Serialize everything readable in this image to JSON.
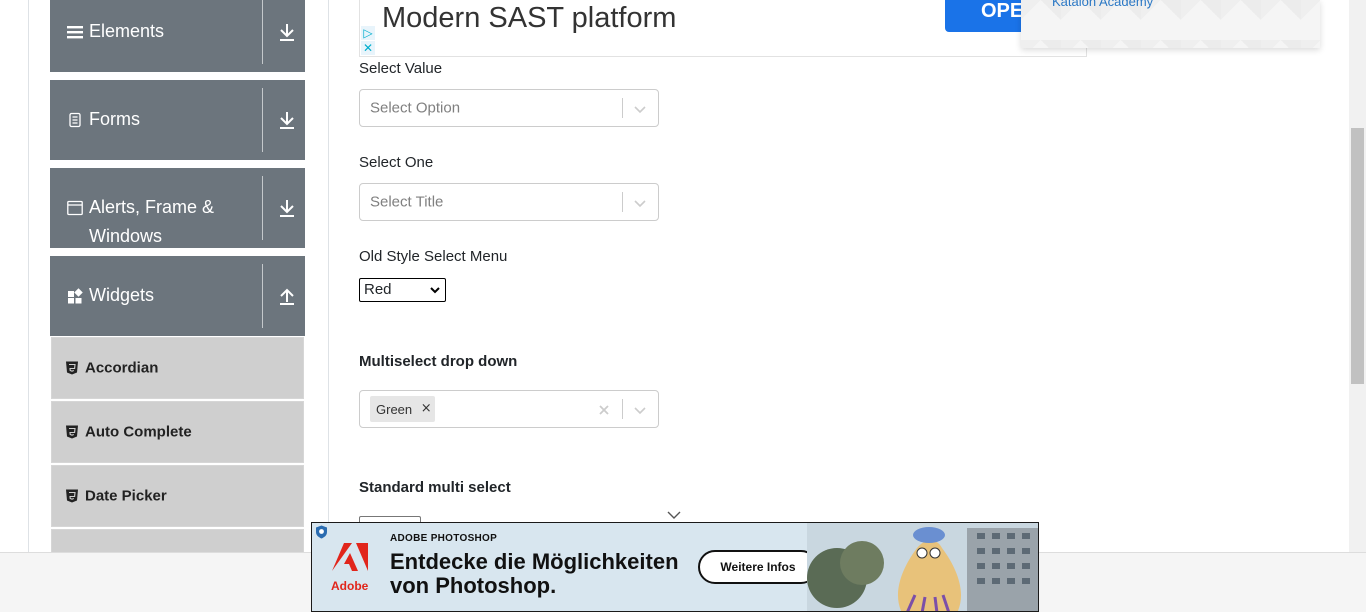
{
  "sidebar": {
    "groups": [
      {
        "label": "Elements",
        "icon": "hamburger-icon",
        "arrow": "download-icon"
      },
      {
        "label": "Forms",
        "icon": "document-icon",
        "arrow": "download-icon"
      },
      {
        "label_line1": "Alerts, Frame &",
        "label_line2": "Windows",
        "icon": "window-icon",
        "arrow": "download-icon"
      },
      {
        "label": "Widgets",
        "icon": "grid-icon",
        "arrow": "upload-icon"
      }
    ],
    "widget_items": [
      {
        "label": "Accordian",
        "icon": "html5-icon"
      },
      {
        "label": "Auto Complete",
        "icon": "html5-icon"
      },
      {
        "label": "Date Picker",
        "icon": "html5-icon"
      }
    ]
  },
  "top_ad": {
    "headline": "Modern SAST platform",
    "button_label": "OPE",
    "adchoices_play": "▷",
    "adchoices_close": "✕",
    "popup_link": "Katalon Academy"
  },
  "form": {
    "select_value": {
      "label": "Select Value",
      "placeholder": "Select Option"
    },
    "select_one": {
      "label": "Select One",
      "placeholder": "Select Title"
    },
    "old_style": {
      "label": "Old Style Select Menu",
      "selected": "Red"
    },
    "multiselect": {
      "label": "Multiselect drop down",
      "tags": [
        "Green"
      ],
      "tag_remove": "×"
    },
    "standard_multi": {
      "label": "Standard multi select"
    }
  },
  "bottom_ad": {
    "eyebrow": "ADOBE PHOTOSHOP",
    "headline_line1": "Entdecke die Möglichkeiten",
    "headline_line2": "von Photoshop.",
    "cta": "Weitere Infos",
    "brand": "Adobe",
    "brand_color": "#e1251b"
  },
  "colors": {
    "sidebar_header": "#6c757d",
    "sidebar_item": "#cfcfcf",
    "accent_blue": "#1a73e8"
  }
}
